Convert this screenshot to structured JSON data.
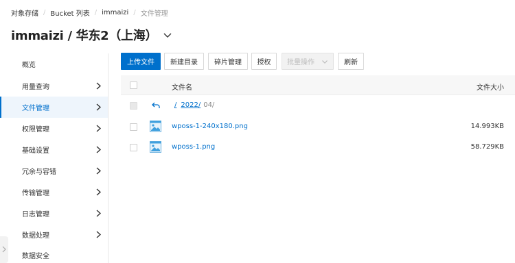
{
  "breadcrumb": [
    "对象存储",
    "Bucket 列表",
    "immaizi",
    "文件管理"
  ],
  "title": "immaizi / 华东2（上海）",
  "sidebar": {
    "items": [
      {
        "label": "概览",
        "has_arrow": false
      },
      {
        "label": "用量查询",
        "has_arrow": true
      },
      {
        "label": "文件管理",
        "has_arrow": true,
        "active": true
      },
      {
        "label": "权限管理",
        "has_arrow": true
      },
      {
        "label": "基础设置",
        "has_arrow": true
      },
      {
        "label": "冗余与容错",
        "has_arrow": true
      },
      {
        "label": "传输管理",
        "has_arrow": true
      },
      {
        "label": "日志管理",
        "has_arrow": true
      },
      {
        "label": "数据处理",
        "has_arrow": true
      },
      {
        "label": "数据安全",
        "has_arrow": false
      }
    ]
  },
  "toolbar": {
    "upload": "上传文件",
    "new_dir": "新建目录",
    "fragments": "碎片管理",
    "authorize": "授权",
    "batch": "批量操作",
    "refresh": "刷新"
  },
  "table": {
    "col_name": "文件名",
    "col_size": "文件大小",
    "path": {
      "root": "/",
      "folder": "2022/",
      "current": "04/"
    },
    "files": [
      {
        "name": "wposs-1-240x180.png",
        "size": "14.993KB"
      },
      {
        "name": "wposs-1.png",
        "size": "58.729KB"
      }
    ]
  },
  "colors": {
    "accent": "#0070cc",
    "active_bg": "#eef5fc"
  }
}
